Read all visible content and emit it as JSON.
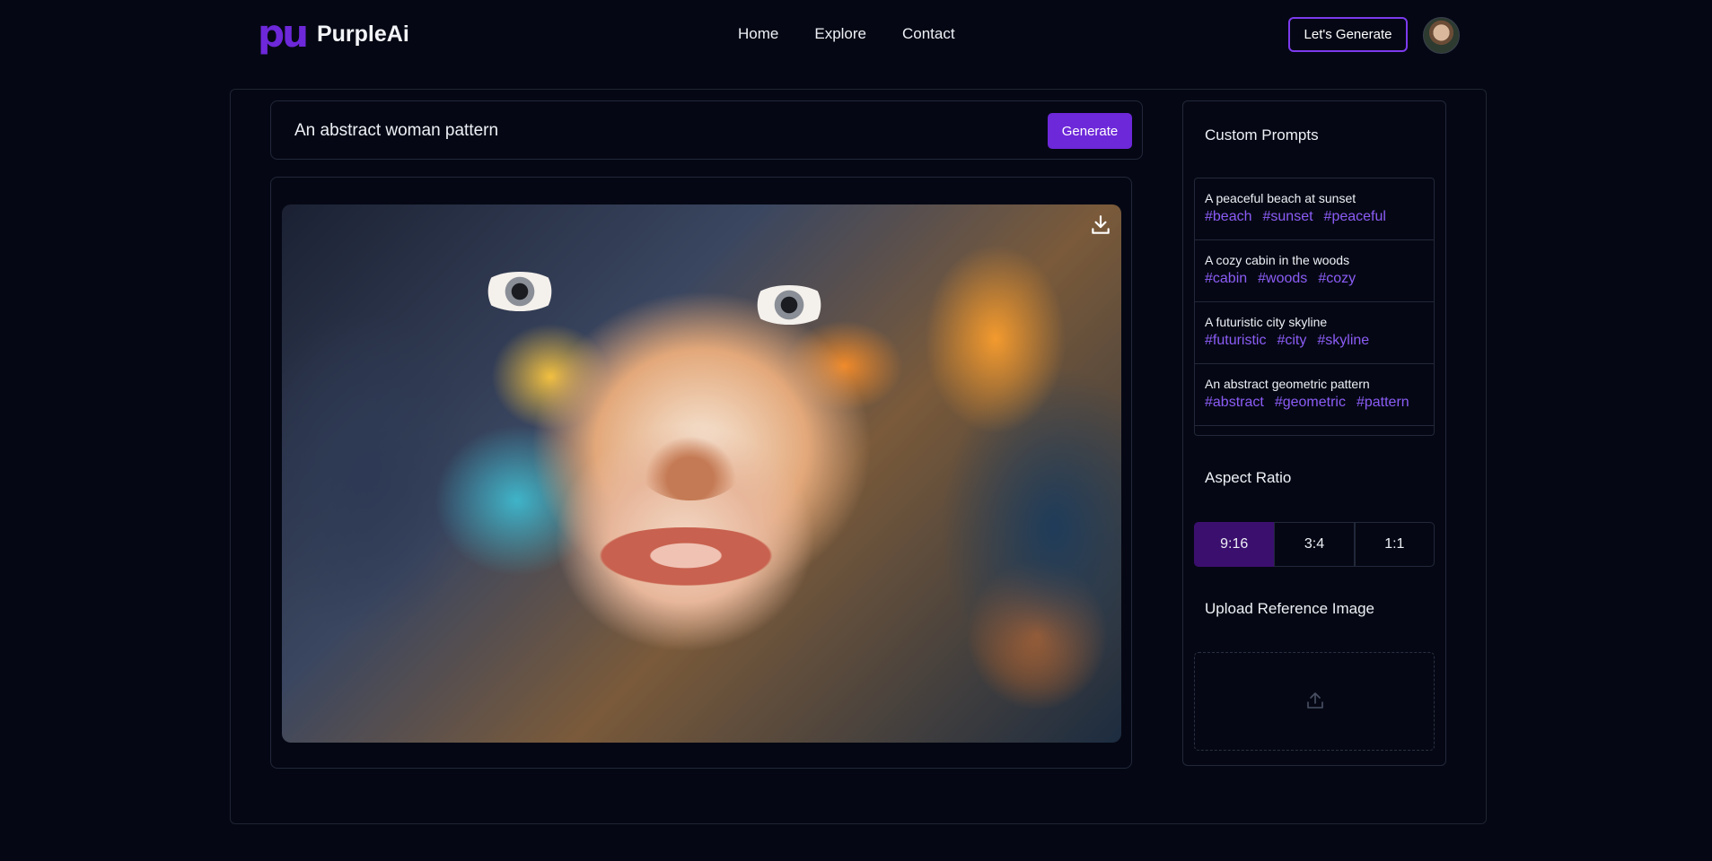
{
  "brand": {
    "mark": "pu",
    "name": "PurpleAi"
  },
  "nav": {
    "items": [
      "Home",
      "Explore",
      "Contact"
    ]
  },
  "header": {
    "cta_label": "Let's Generate"
  },
  "prompt": {
    "value": "An abstract woman pattern",
    "button_label": "Generate"
  },
  "sidebar": {
    "custom_prompts_title": "Custom Prompts",
    "custom_prompts": [
      {
        "text": "A peaceful beach at sunset",
        "tags": [
          "#beach",
          "#sunset",
          "#peaceful"
        ]
      },
      {
        "text": "A cozy cabin in the woods",
        "tags": [
          "#cabin",
          "#woods",
          "#cozy"
        ]
      },
      {
        "text": "A futuristic city skyline",
        "tags": [
          "#futuristic",
          "#city",
          "#skyline"
        ]
      },
      {
        "text": "An abstract geometric pattern",
        "tags": [
          "#abstract",
          "#geometric",
          "#pattern"
        ]
      }
    ],
    "aspect_ratio_title": "Aspect Ratio",
    "aspect_ratios": [
      "9:16",
      "3:4",
      "1:1"
    ],
    "selected_ratio": "9:16",
    "upload_title": "Upload Reference Image"
  },
  "icons": {
    "download": "download-icon",
    "upload": "upload-icon"
  },
  "colors": {
    "accent": "#6d28d9",
    "tag": "#8b5cf6",
    "background": "#050814",
    "selected_ratio_bg": "#3b0f6e"
  }
}
